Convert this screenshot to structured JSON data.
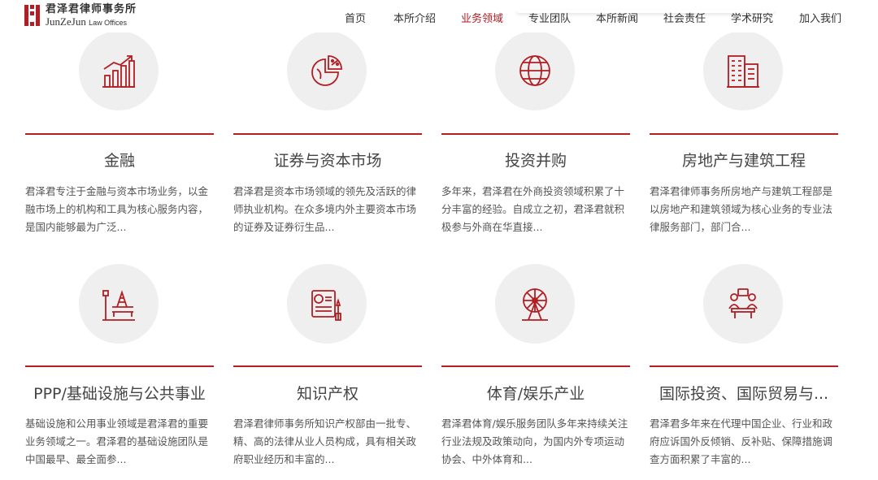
{
  "brand": {
    "name_cn": "君泽君律师事务所",
    "name_en": "JunZeJun",
    "name_en_suffix": "Law Offices",
    "color": "#b11e23"
  },
  "nav": {
    "items": [
      {
        "label": "首页"
      },
      {
        "label": "本所介绍"
      },
      {
        "label": "业务领域",
        "active": true
      },
      {
        "label": "专业团队"
      },
      {
        "label": "本所新闻"
      },
      {
        "label": "社会责任"
      },
      {
        "label": "学术研究"
      },
      {
        "label": "加入我们"
      }
    ]
  },
  "practice_areas": [
    {
      "title": "金融",
      "icon": "bar-chart-growth-icon",
      "description": "君泽君专注于金融与资本市场业务，以金融市场上的机构和工具为核心服务内容，是国内能够最为广泛..."
    },
    {
      "title": "证券与资本市场",
      "icon": "pie-chart-percent-icon",
      "description": "君泽君是资本市场领域的领先及活跃的律师执业机构。在众多境内外主要资本市场的证券及证券衍生品..."
    },
    {
      "title": "投资并购",
      "icon": "globe-icon",
      "description": "多年来，君泽君在外商投资领域积累了十分丰富的经验。自成立之初，君泽君就积极参与外商在华直接..."
    },
    {
      "title": "房地产与建筑工程",
      "icon": "buildings-icon",
      "description": "君泽君律师事务所房地产与建筑工程部是以房地产和建筑领域为核心业务的专业法律服务部门，部门合..."
    },
    {
      "title": "PPP/基础设施与公共事业",
      "icon": "park-bench-lamp-icon",
      "description": "基础设施和公用事业领域是君泽君的重要业务领域之一。君泽君的基础设施团队是中国最早、最全面参..."
    },
    {
      "title": "知识产权",
      "icon": "certificate-scroll-icon",
      "description": "君泽君律师事务所知识产权部由一批专、精、高的法律从业人员构成，具有相关政府职业经历和丰富的..."
    },
    {
      "title": "体育/娱乐产业",
      "icon": "ferris-wheel-icon",
      "description": "君泽君体育/娱乐服务团队多年来持续关注行业法规及政策动向，为国内外专项运动协会、中外体育和..."
    },
    {
      "title": "国际投资、国际贸易与...",
      "icon": "meeting-table-icon",
      "description": "君泽君多年来在代理中国企业、行业和政府应诉国外反倾销、反补贴、保障措施调查方面积累了丰富的..."
    }
  ]
}
